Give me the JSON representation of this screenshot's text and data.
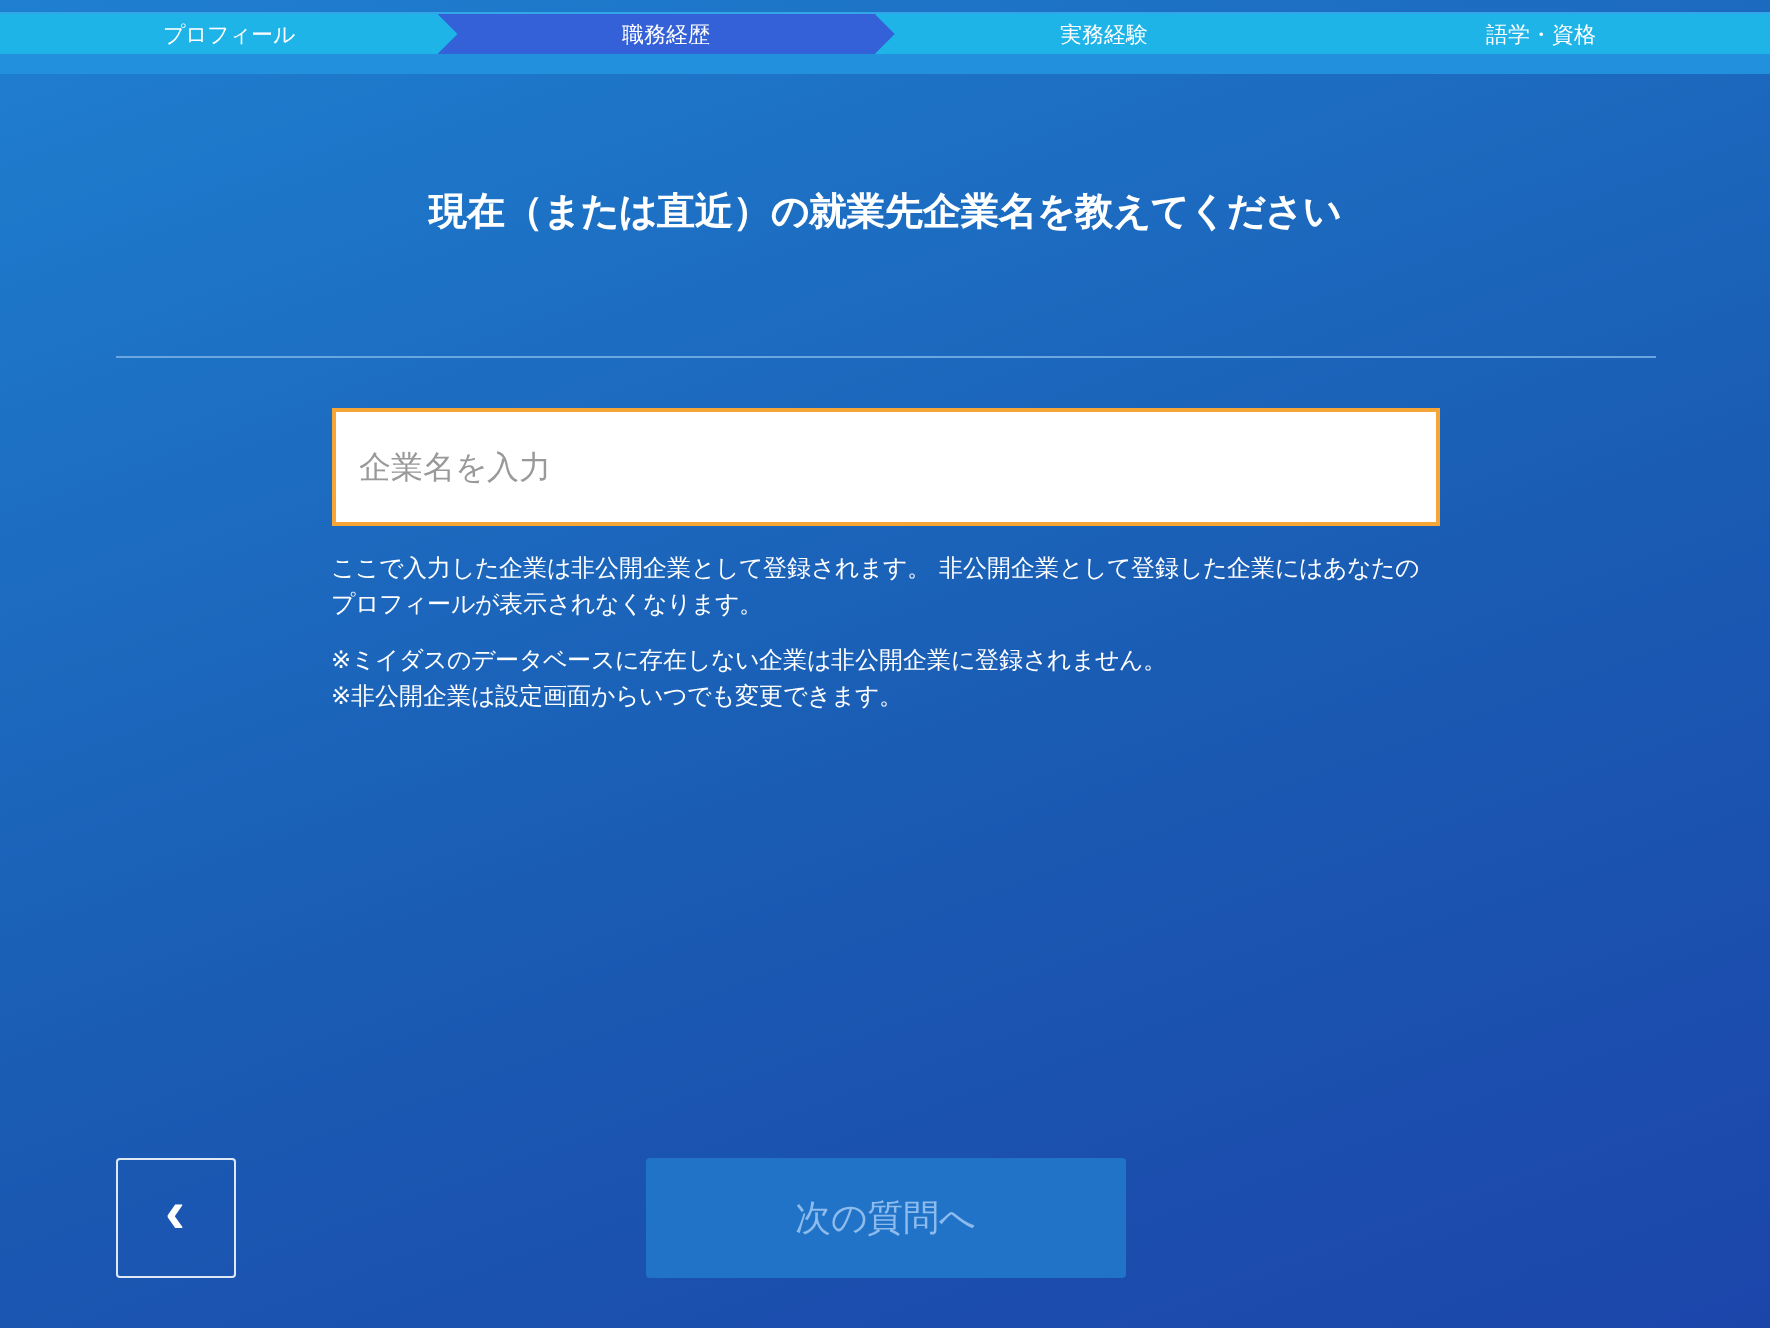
{
  "steps": [
    {
      "label": "プロフィール",
      "selected": false
    },
    {
      "label": "職務経歴",
      "selected": true
    },
    {
      "label": "実務経験",
      "selected": false
    },
    {
      "label": "語学・資格",
      "selected": false
    }
  ],
  "question": "現在（または直近）の就業先企業名を教えてください",
  "company_field": {
    "placeholder": "企業名を入力",
    "focused": true
  },
  "notes": [
    "ここで入力した企業は非公開企業として登録されます。 非公開企業として登録した企業にはあなたのプロフィールが表示されなくなります。"
  ],
  "footnotes": [
    "※ミイダスのデータベースに存在しない企業は非公開企業に登録されません。",
    "※非公開企業は設定画面からいつでも変更できます。"
  ],
  "back_button": {
    "label": "‹"
  },
  "next_button": {
    "label": "次の質問へ",
    "disabled": true
  }
}
